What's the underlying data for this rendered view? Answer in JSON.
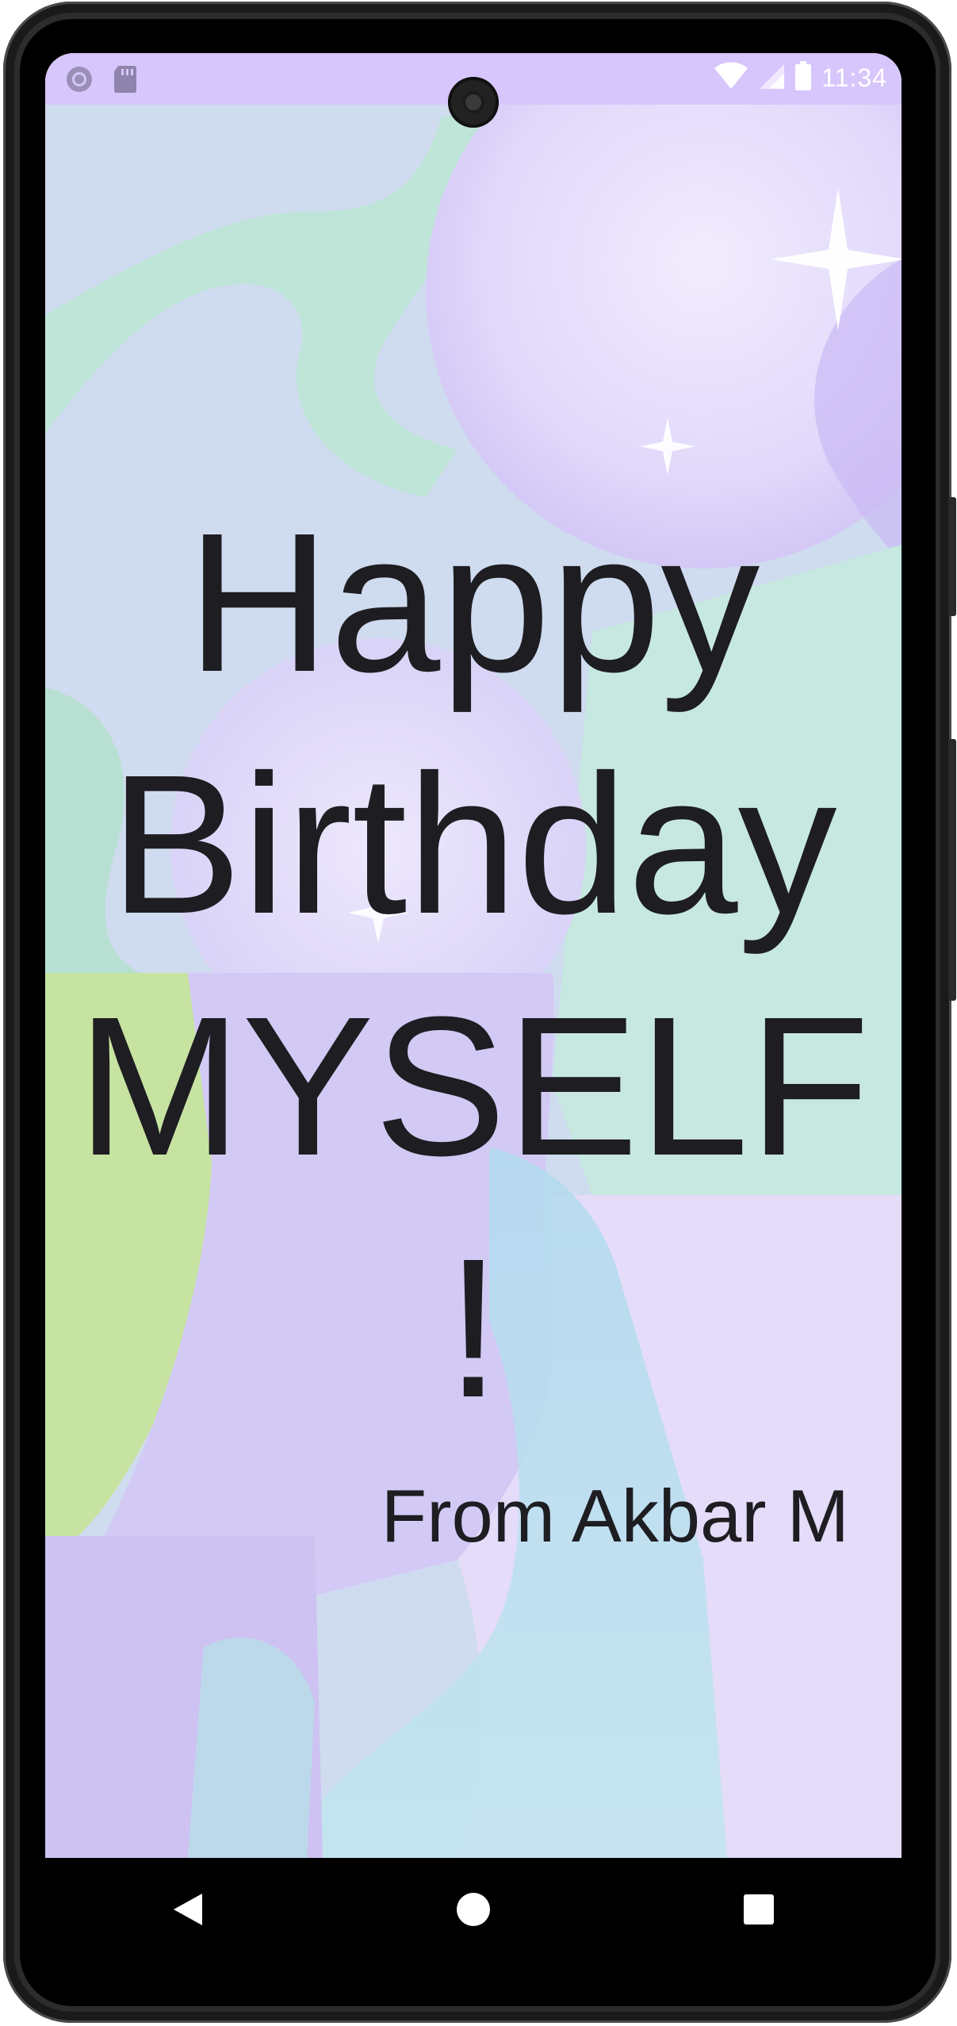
{
  "status_bar": {
    "time": "11:34",
    "left_icons": [
      "record-icon",
      "sd-card-icon"
    ],
    "right_icons": [
      "wifi-icon",
      "cellular-signal-icon",
      "battery-icon"
    ]
  },
  "app": {
    "greeting": "Happy Birthday MYSELF !",
    "signature": "From Akbar M"
  },
  "nav_bar": {
    "buttons": [
      "back-icon",
      "home-icon",
      "recents-icon"
    ]
  },
  "colors": {
    "status_bar": "#d7c6fb",
    "text": "#1e1d22",
    "bezel": "#2c2c2c"
  }
}
